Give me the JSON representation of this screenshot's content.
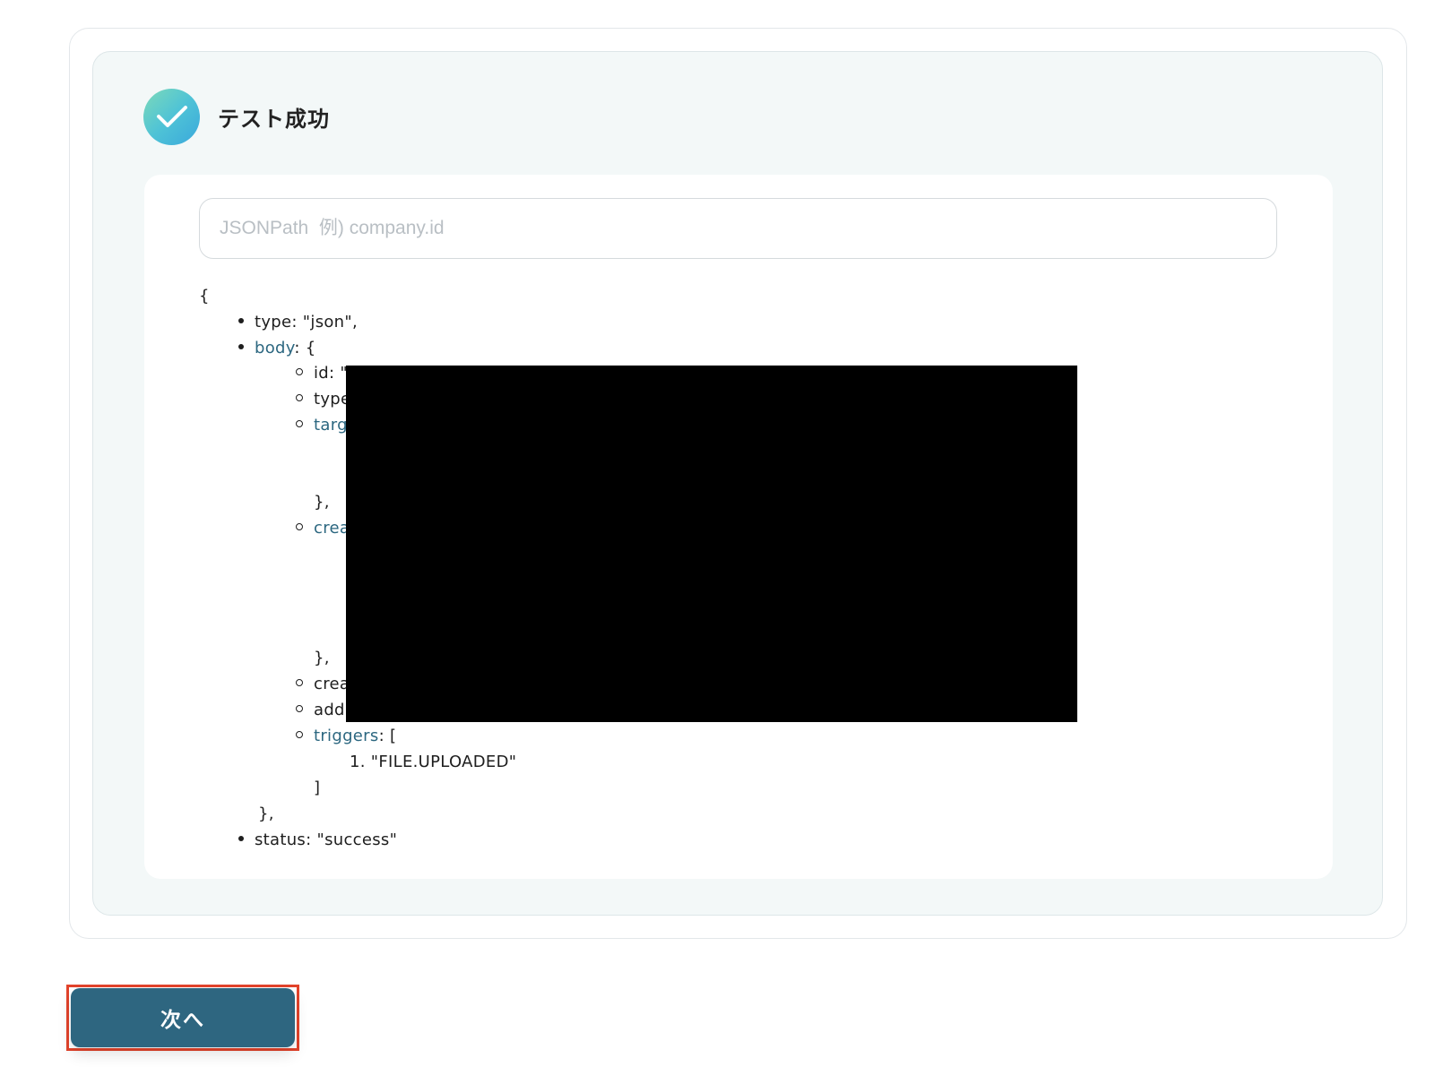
{
  "header": {
    "title": "テスト成功",
    "icon": "check-icon"
  },
  "search": {
    "placeholder": "JSONPath  例) company.id",
    "value": ""
  },
  "json_lines": {
    "open_brace": "{",
    "type_key": "type",
    "type_value": ": \"json\",",
    "body_key": "body",
    "body_open": ": {",
    "id_partial": "id: \"",
    "type_partial": "type",
    "target_partial": "targ",
    "close_1": "},",
    "created_partial": "crea",
    "close_2": "},",
    "created2_partial": "crea",
    "added_partial": "add",
    "triggers_key": "triggers",
    "triggers_open": ": [",
    "trigger_item": "1. \"FILE.UPLOADED\"",
    "triggers_close": "]",
    "body_close": "},",
    "status_line": "status: \"success\""
  },
  "actions": {
    "next_label": "次へ"
  },
  "colors": {
    "accent": "#2e6680",
    "highlight_border": "#e2432b",
    "key_link": "#2c6780"
  }
}
